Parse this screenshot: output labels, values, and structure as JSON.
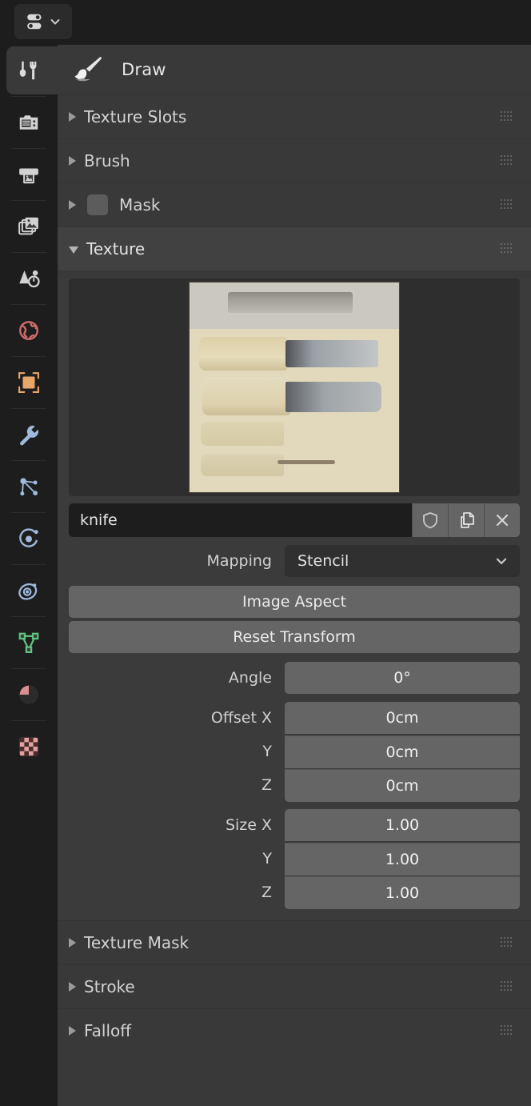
{
  "header": {
    "editor_type_icon": "properties-editor-icon",
    "dropdown_icon": "chevron-down-icon"
  },
  "tabs": [
    {
      "name": "tool",
      "icon": "tool-icon",
      "active": true
    },
    {
      "name": "render",
      "icon": "camera-back-icon",
      "active": false
    },
    {
      "name": "output",
      "icon": "printer-icon",
      "active": false
    },
    {
      "name": "view-layer",
      "icon": "images-icon",
      "active": false
    },
    {
      "name": "scene",
      "icon": "scene-icon",
      "active": false
    },
    {
      "name": "world",
      "icon": "world-globe-icon",
      "active": false
    },
    {
      "name": "object",
      "icon": "object-square-icon",
      "active": false
    },
    {
      "name": "modifiers",
      "icon": "wrench-icon",
      "active": false
    },
    {
      "name": "particles",
      "icon": "particles-icon",
      "active": false
    },
    {
      "name": "physics",
      "icon": "physics-orbit-icon",
      "active": false
    },
    {
      "name": "constraints",
      "icon": "constraint-icon",
      "active": false
    },
    {
      "name": "object-data",
      "icon": "mesh-data-icon",
      "active": false
    },
    {
      "name": "material",
      "icon": "material-sphere-icon",
      "active": false
    },
    {
      "name": "texture",
      "icon": "texture-checker-icon",
      "active": false
    }
  ],
  "tool": {
    "icon": "brush-icon",
    "name": "Draw"
  },
  "panels": [
    {
      "title": "Texture Slots",
      "open": false,
      "checkbox": false
    },
    {
      "title": "Brush",
      "open": false,
      "checkbox": false
    },
    {
      "title": "Mask",
      "open": false,
      "checkbox": true
    },
    {
      "title": "Texture",
      "open": true,
      "checkbox": false
    }
  ],
  "bottom_panels": [
    {
      "title": "Texture Mask",
      "open": false
    },
    {
      "title": "Stroke",
      "open": false
    },
    {
      "title": "Falloff",
      "open": false
    }
  ],
  "texture": {
    "preview_alt": "knife texture preview",
    "name": "knife",
    "buttons": {
      "fake_user": "shield-icon",
      "duplicate": "copy-icon",
      "unlink": "close-x-icon"
    },
    "mapping_label": "Mapping",
    "mapping_value": "Stencil",
    "image_aspect_label": "Image Aspect",
    "reset_transform_label": "Reset Transform",
    "angle_label": "Angle",
    "angle_value": "0°",
    "offset_label": "Offset X",
    "offset_y_label": "Y",
    "offset_z_label": "Z",
    "offset_x_value": "0cm",
    "offset_y_value": "0cm",
    "offset_z_value": "0cm",
    "size_label": "Size X",
    "size_y_label": "Y",
    "size_z_label": "Z",
    "size_x_value": "1.00",
    "size_y_value": "1.00",
    "size_z_value": "1.00"
  },
  "colors": {
    "panel_bg": "#393939",
    "editor_bg": "#1d1d1d",
    "field_bg": "#656565",
    "text": "#e2e2e2",
    "world_accent": "#d06a6a",
    "object_accent": "#e8a76a",
    "modifier_accent": "#9fbadc",
    "data_accent": "#5fc27e",
    "texture_accent": "#e0a0a0"
  }
}
